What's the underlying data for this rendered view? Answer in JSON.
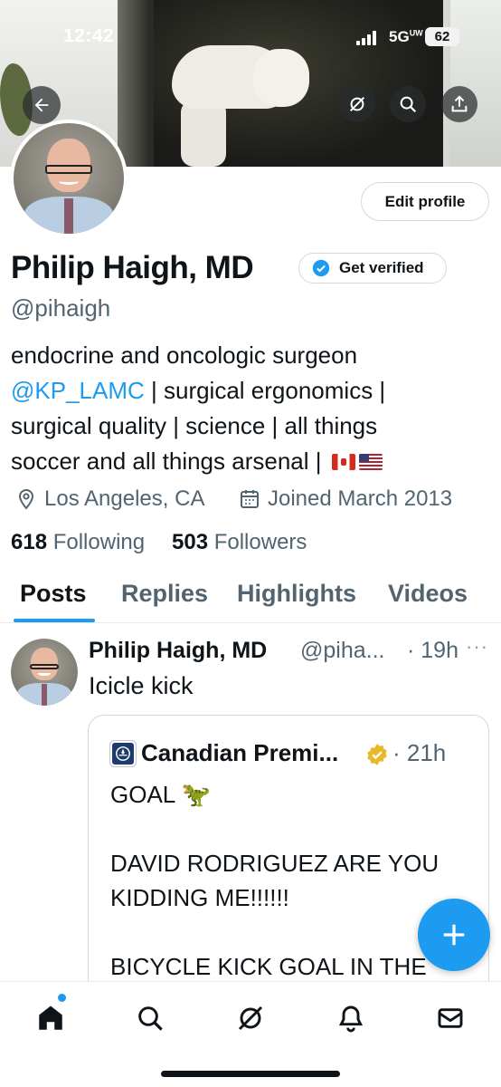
{
  "status_bar": {
    "time": "12:42",
    "network": "5G",
    "network_sup": "UW",
    "battery": "62"
  },
  "banner": {
    "description_icons": [
      "back-icon",
      "mute-icon",
      "search-icon",
      "share-icon"
    ]
  },
  "profile": {
    "edit_button": "Edit profile",
    "name": "Philip Haigh, MD",
    "get_verified": "Get verified",
    "handle": "@pihaigh",
    "bio_line1": "endocrine and oncologic surgeon",
    "bio_link": "@KP_LAMC",
    "bio_rest1": " | surgical ergonomics |",
    "bio_line3": "surgical quality | science | all things",
    "bio_line4": "soccer and all things arsenal | ",
    "location": "Los Angeles, CA",
    "joined": "Joined March 2013",
    "following_count": "618",
    "following_label": "Following",
    "followers_count": "503",
    "followers_label": "Followers"
  },
  "tabs": [
    {
      "label": "Posts",
      "active": true
    },
    {
      "label": "Replies",
      "active": false
    },
    {
      "label": "Highlights",
      "active": false
    },
    {
      "label": "Videos",
      "active": false
    }
  ],
  "post": {
    "author": "Philip Haigh, MD",
    "handle": "@piha...",
    "time": "· 19h",
    "more": "···",
    "text": "Icicle kick",
    "quote": {
      "author": "Canadian Premi...",
      "time": "· 21h",
      "text": "GOAL 🦖\n\nDAVID RODRIGUEZ ARE YOU KIDDING ME!!!!!!\n\nBICYCLE KICK GOAL IN THE"
    }
  },
  "colors": {
    "accent": "#1d9bf0",
    "text_primary": "#0f1419",
    "text_secondary": "#536471",
    "border": "#cfd9de"
  },
  "bottom_nav": [
    "home-icon",
    "search-icon",
    "grok-icon",
    "notifications-icon",
    "messages-icon"
  ]
}
